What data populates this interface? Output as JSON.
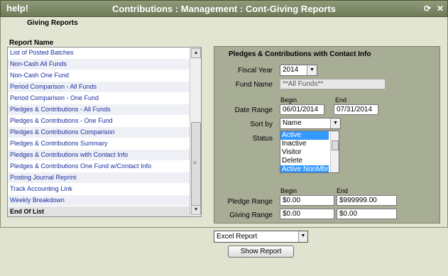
{
  "window": {
    "help_label": "help!",
    "title": "Contributions : Management : Cont-Giving Reports",
    "refresh_icon": "refresh-icon",
    "close_icon": "close-icon"
  },
  "heading": "Giving Reports",
  "reports": {
    "label": "Report Name",
    "items": [
      "List of Posted Batches",
      "Non-Cash All Funds",
      "Non-Cash One Fund",
      "Period Comparison - All Funds",
      "Period Comparison - One Fund",
      "Pledges & Contributions - All Funds",
      "Pledges & Contributions - One Fund",
      "Pledges & Contributions Comparison",
      "Pledges & Contributions Summary",
      "Pledges & Contributions with Contact Info",
      "Pledges & Contributions One Fund w/Contact Info",
      "Posting Journal Reprint",
      "Track Accounting Link",
      "Weekly Breakdown"
    ],
    "end_label": "End Of List"
  },
  "panel": {
    "title": "Pledges & Contributions with Contact Info",
    "fiscal_year_label": "Fiscal Year",
    "fiscal_year": "2014",
    "fund_name_label": "Fund Name",
    "fund_name": "**All Funds**",
    "begin_label": "Begin",
    "end_label": "End",
    "date_range_label": "Date Range",
    "date_begin": "06/01/2014",
    "date_end": "07/31/2014",
    "sort_by_label": "Sort by",
    "sort_by": "Name",
    "status_label": "Status",
    "status_options": [
      {
        "label": "Active",
        "selected": true
      },
      {
        "label": "Inactive",
        "selected": false
      },
      {
        "label": "Visitor",
        "selected": false
      },
      {
        "label": "Delete",
        "selected": false
      },
      {
        "label": "Active NonMbr",
        "selected": true
      }
    ],
    "pledge_begin_label": "Begin",
    "pledge_end_label": "End",
    "pledge_range_label": "Pledge Range",
    "pledge_begin": "$0.00",
    "pledge_end": "$999999.00",
    "giving_range_label": "Giving Range",
    "giving_begin": "$0.00",
    "giving_end": "$0.00"
  },
  "output": {
    "format": "Excel Report",
    "show_button": "Show Report"
  }
}
